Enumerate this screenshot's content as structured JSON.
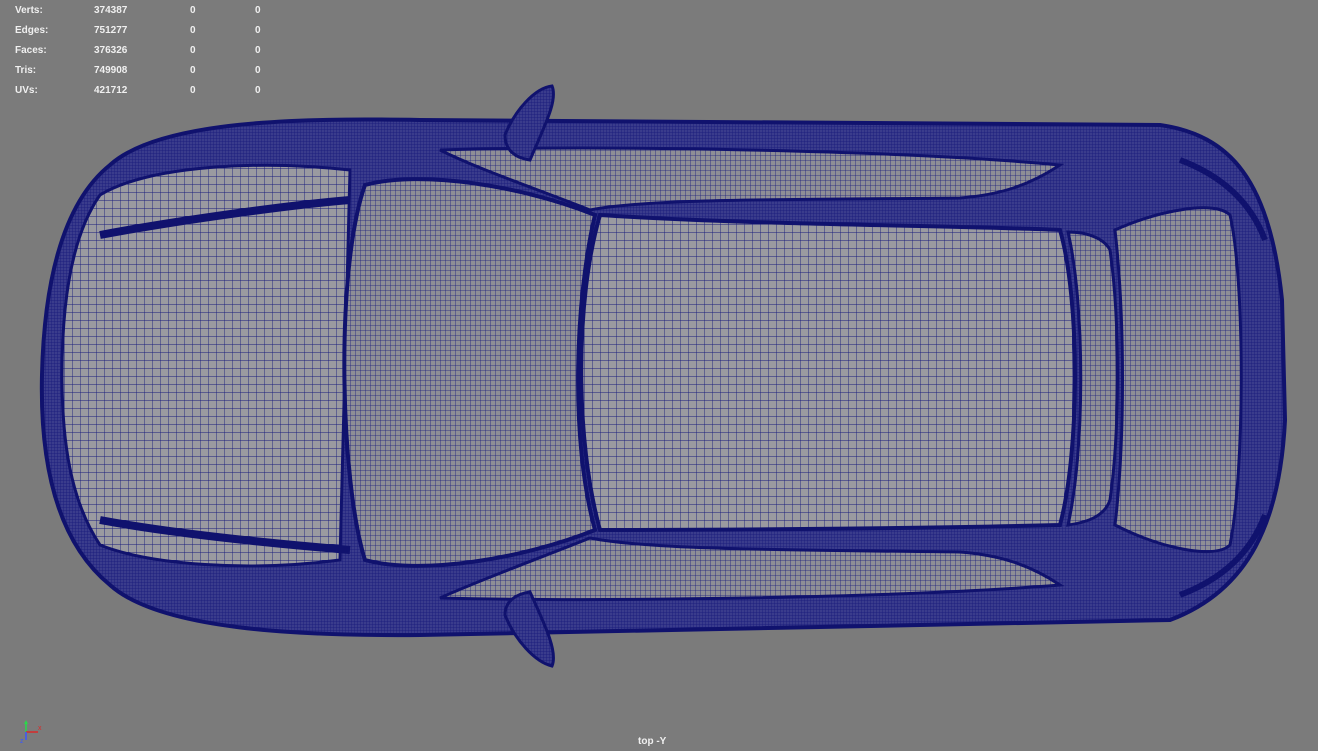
{
  "heads_up_display": {
    "rows": [
      {
        "label": "Verts:",
        "total": "374387",
        "selected": "0",
        "components": "0"
      },
      {
        "label": "Edges:",
        "total": "751277",
        "selected": "0",
        "components": "0"
      },
      {
        "label": "Faces:",
        "total": "376326",
        "selected": "0",
        "components": "0"
      },
      {
        "label": "Tris:",
        "total": "749908",
        "selected": "0",
        "components": "0"
      },
      {
        "label": "UVs:",
        "total": "421712",
        "selected": "0",
        "components": "0"
      }
    ]
  },
  "viewport": {
    "camera_label": "top -Y",
    "background_color": "#7b7b7b",
    "wireframe_color": "#16187a",
    "model": "car-wireframe-top-view"
  },
  "axis_gizmo": {
    "icon": "axis-gizmo-icon",
    "x_color": "#d92a2a",
    "y_color": "#2ad94a",
    "z_color": "#3a56ff"
  }
}
